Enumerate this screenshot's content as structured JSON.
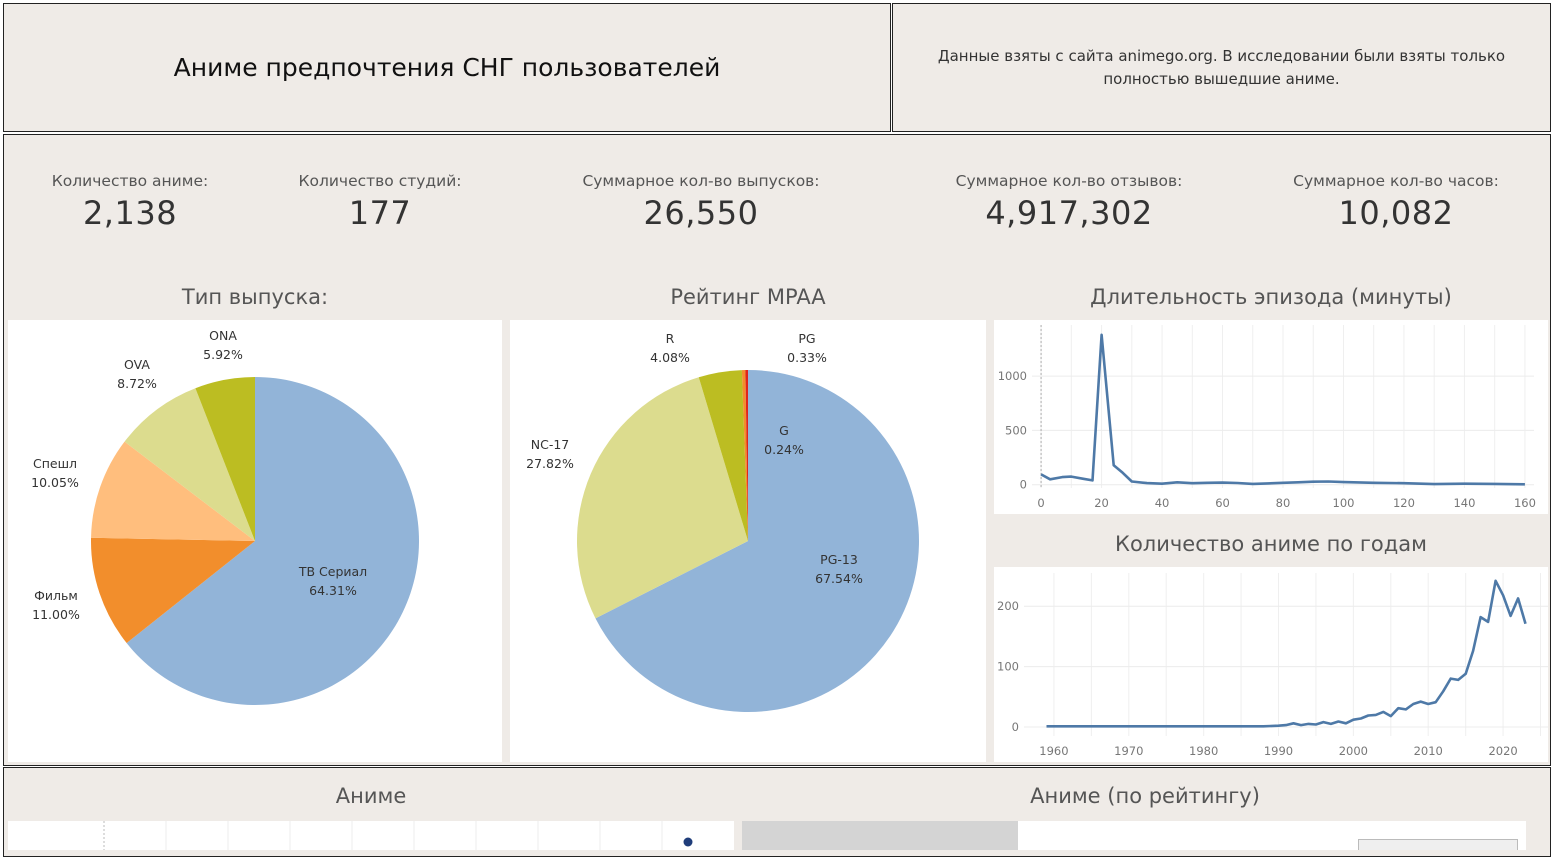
{
  "header": {
    "title": "Аниме предпочтения СНГ пользователей",
    "note": "Данные  взяты с сайта animego.org. В исследовании были взяты только полностью вышедшие аниме."
  },
  "kpis": [
    {
      "label": "Количество аниме:",
      "value": "2,138"
    },
    {
      "label": "Количество студий:",
      "value": "177"
    },
    {
      "label": "Суммарное кол-во выпусков:",
      "value": "26,550"
    },
    {
      "label": "Суммарное кол-во отзывов:",
      "value": "4,917,302"
    },
    {
      "label": "Суммарное кол-во часов:",
      "value": "10,082"
    }
  ],
  "section_titles": {
    "type": "Тип выпуска:",
    "mpaa": "Рейтинг MPAA",
    "duration": "Длительность эпизода (минуты)",
    "years": "Количество аниме по годам",
    "anime": "Аниме",
    "anime_rating": "Аниме (по рейтингу)"
  },
  "colors": {
    "background": "#efebe7",
    "line": "#4e79a7"
  },
  "chart_data": [
    {
      "type": "pie",
      "title": "Тип выпуска:",
      "slices": [
        {
          "label": "ТВ Сериал",
          "value": 64.31,
          "pct": "64.31%",
          "color": "#92b4d8"
        },
        {
          "label": "Фильм",
          "value": 11.0,
          "pct": "11.00%",
          "color": "#f28e2c"
        },
        {
          "label": "Спешл",
          "value": 10.05,
          "pct": "10.05%",
          "color": "#ffbe7d"
        },
        {
          "label": "OVA",
          "value": 8.72,
          "pct": "8.72%",
          "color": "#dcdc8e"
        },
        {
          "label": "ONA",
          "value": 5.92,
          "pct": "5.92%",
          "color": "#bcbd22"
        }
      ]
    },
    {
      "type": "pie",
      "title": "Рейтинг MPAA",
      "slices": [
        {
          "label": "PG-13",
          "value": 67.54,
          "pct": "67.54%",
          "color": "#92b4d8"
        },
        {
          "label": "NC-17",
          "value": 27.82,
          "pct": "27.82%",
          "color": "#dcdc8e"
        },
        {
          "label": "R",
          "value": 4.08,
          "pct": "4.08%",
          "color": "#bcbd22"
        },
        {
          "label": "PG",
          "value": 0.33,
          "pct": "0.33%",
          "color": "#f28e2c"
        },
        {
          "label": "G",
          "value": 0.24,
          "pct": "0.24%",
          "color": "#e0261a"
        }
      ]
    },
    {
      "type": "line",
      "title": "Длительность эпизода (минуты)",
      "xlim": [
        -3,
        163
      ],
      "ylim": [
        -30,
        1470
      ],
      "xticks": [
        0,
        20,
        40,
        60,
        80,
        100,
        120,
        140,
        160
      ],
      "yticks": [
        0,
        500,
        1000
      ],
      "x": [
        0,
        3,
        7,
        10,
        14,
        17,
        20,
        24,
        27,
        30,
        35,
        40,
        45,
        50,
        55,
        60,
        65,
        70,
        75,
        80,
        85,
        90,
        95,
        100,
        110,
        120,
        130,
        140,
        150,
        160
      ],
      "y": [
        95,
        50,
        70,
        75,
        55,
        40,
        1380,
        180,
        110,
        30,
        15,
        10,
        22,
        14,
        18,
        20,
        16,
        8,
        12,
        18,
        22,
        28,
        30,
        24,
        18,
        14,
        6,
        10,
        8,
        4
      ]
    },
    {
      "type": "line",
      "title": "Количество аниме по годам",
      "xlim": [
        1956,
        2026
      ],
      "ylim": [
        -15,
        255
      ],
      "xticks": [
        1960,
        1970,
        1980,
        1990,
        2000,
        2010,
        2020
      ],
      "yticks": [
        0,
        100,
        200
      ],
      "x": [
        1959,
        1965,
        1970,
        1975,
        1980,
        1985,
        1988,
        1990,
        1991,
        1992,
        1993,
        1994,
        1995,
        1996,
        1997,
        1998,
        1999,
        2000,
        2001,
        2002,
        2003,
        2004,
        2005,
        2006,
        2007,
        2008,
        2009,
        2010,
        2011,
        2012,
        2013,
        2014,
        2015,
        2016,
        2017,
        2018,
        2019,
        2020,
        2021,
        2022,
        2023
      ],
      "y": [
        1,
        1,
        1,
        1,
        1,
        1,
        1,
        2,
        3,
        6,
        3,
        5,
        4,
        8,
        5,
        9,
        6,
        12,
        14,
        19,
        20,
        25,
        18,
        31,
        29,
        38,
        42,
        38,
        41,
        59,
        80,
        78,
        88,
        126,
        182,
        174,
        242,
        218,
        184,
        213,
        171
      ]
    }
  ]
}
